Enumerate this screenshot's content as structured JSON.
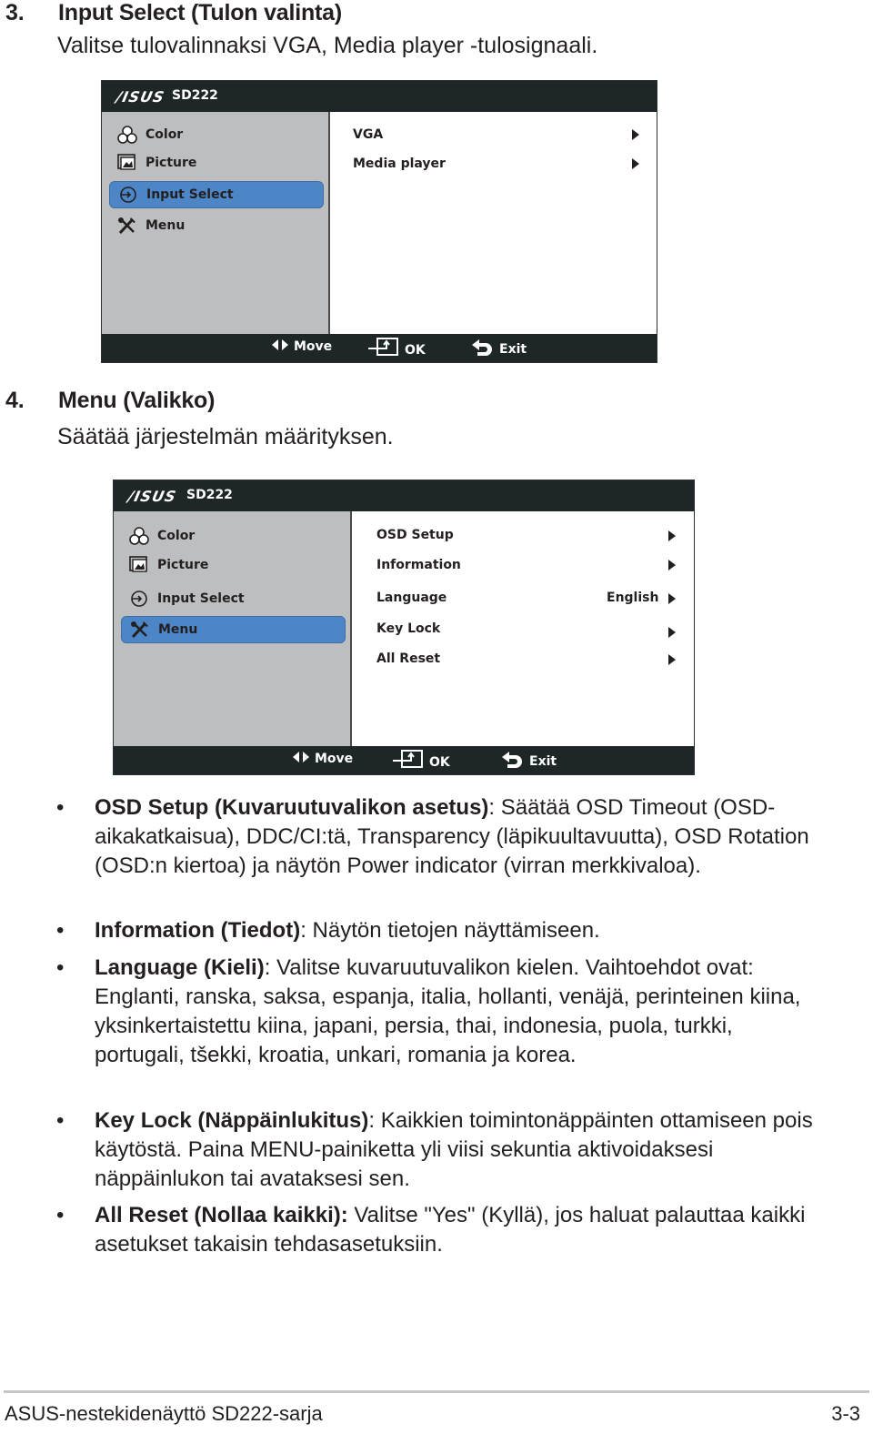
{
  "section3": {
    "number": "3.",
    "title": "Input Select (Tulon valinta)",
    "description": "Valitse tulovalinnaksi VGA, Media player -tulosignaali."
  },
  "osd1": {
    "brand": "/ISUS",
    "model": "SD222",
    "nav": [
      {
        "label": "Color",
        "icon": "color-rgb-icon",
        "active": false
      },
      {
        "label": "Picture",
        "icon": "picture-icon",
        "active": false
      },
      {
        "label": "Input Select",
        "icon": "input-select-icon",
        "active": true
      },
      {
        "label": "Menu",
        "icon": "menu-tools-icon",
        "active": false
      }
    ],
    "options": [
      {
        "label": "VGA",
        "value": ""
      },
      {
        "label": "Media player",
        "value": ""
      }
    ],
    "footer": {
      "move": "Move",
      "ok": "OK",
      "exit": "Exit"
    }
  },
  "section4": {
    "number": "4.",
    "title": "Menu (Valikko)",
    "description": "Säätää järjestelmän määrityksen."
  },
  "osd2": {
    "brand": "/ISUS",
    "model": "SD222",
    "nav": [
      {
        "label": "Color",
        "icon": "color-rgb-icon",
        "active": false
      },
      {
        "label": "Picture",
        "icon": "picture-icon",
        "active": false
      },
      {
        "label": "Input Select",
        "icon": "input-select-icon",
        "active": false
      },
      {
        "label": "Menu",
        "icon": "menu-tools-icon",
        "active": true
      }
    ],
    "options": [
      {
        "label": "OSD Setup",
        "value": ""
      },
      {
        "label": "Information",
        "value": ""
      },
      {
        "label": "Language",
        "value": "English"
      },
      {
        "label": "Key Lock",
        "value": ""
      },
      {
        "label": "All Reset",
        "value": ""
      }
    ],
    "footer": {
      "move": "Move",
      "ok": "OK",
      "exit": "Exit"
    }
  },
  "bullets": [
    {
      "bold": "OSD Setup (Kuvaruutuvalikon asetus)",
      "text": ": Säätää OSD Timeout (OSD-aikakatkaisua), DDC/CI:tä, Transparency (läpikuultavuutta), OSD Rotation (OSD:n kiertoa) ja näytön Power indicator (virran merkkivaloa)."
    },
    {
      "bold": "Information (Tiedot)",
      "text": ": Näytön tietojen näyttämiseen."
    },
    {
      "bold": "Language (Kieli)",
      "text": ": Valitse kuvaruutuvalikon kielen. Vaihtoehdot ovat: Englanti, ranska, saksa, espanja, italia, hollanti, venäjä, perinteinen kiina, yksinkertaistettu kiina, japani, persia, thai, indonesia, puola, turkki, portugali, tšekki, kroatia, unkari, romania ja korea."
    },
    {
      "bold": "Key Lock (Näppäinlukitus)",
      "text": ": Kaikkien toimintonäppäinten ottamiseen pois käytöstä. Paina MENU-painiketta yli viisi sekuntia aktivoidaksesi näppäinlukon tai avataksesi sen."
    },
    {
      "bold": "All Reset (Nollaa kaikki):",
      "text": " Valitse \"Yes\" (Kyllä), jos haluat palauttaa kaikki asetukset takaisin tehdasasetuksiin."
    }
  ],
  "bullet_symbol": "•",
  "footer": {
    "title": "ASUS-nestekidenäyttö SD222-sarja",
    "page": "3-3"
  },
  "colors": {
    "osd_bar": "#1f2627",
    "osd_left_panel": "#bdbec0",
    "osd_highlight": "#4d86c6",
    "text": "#231f20"
  }
}
